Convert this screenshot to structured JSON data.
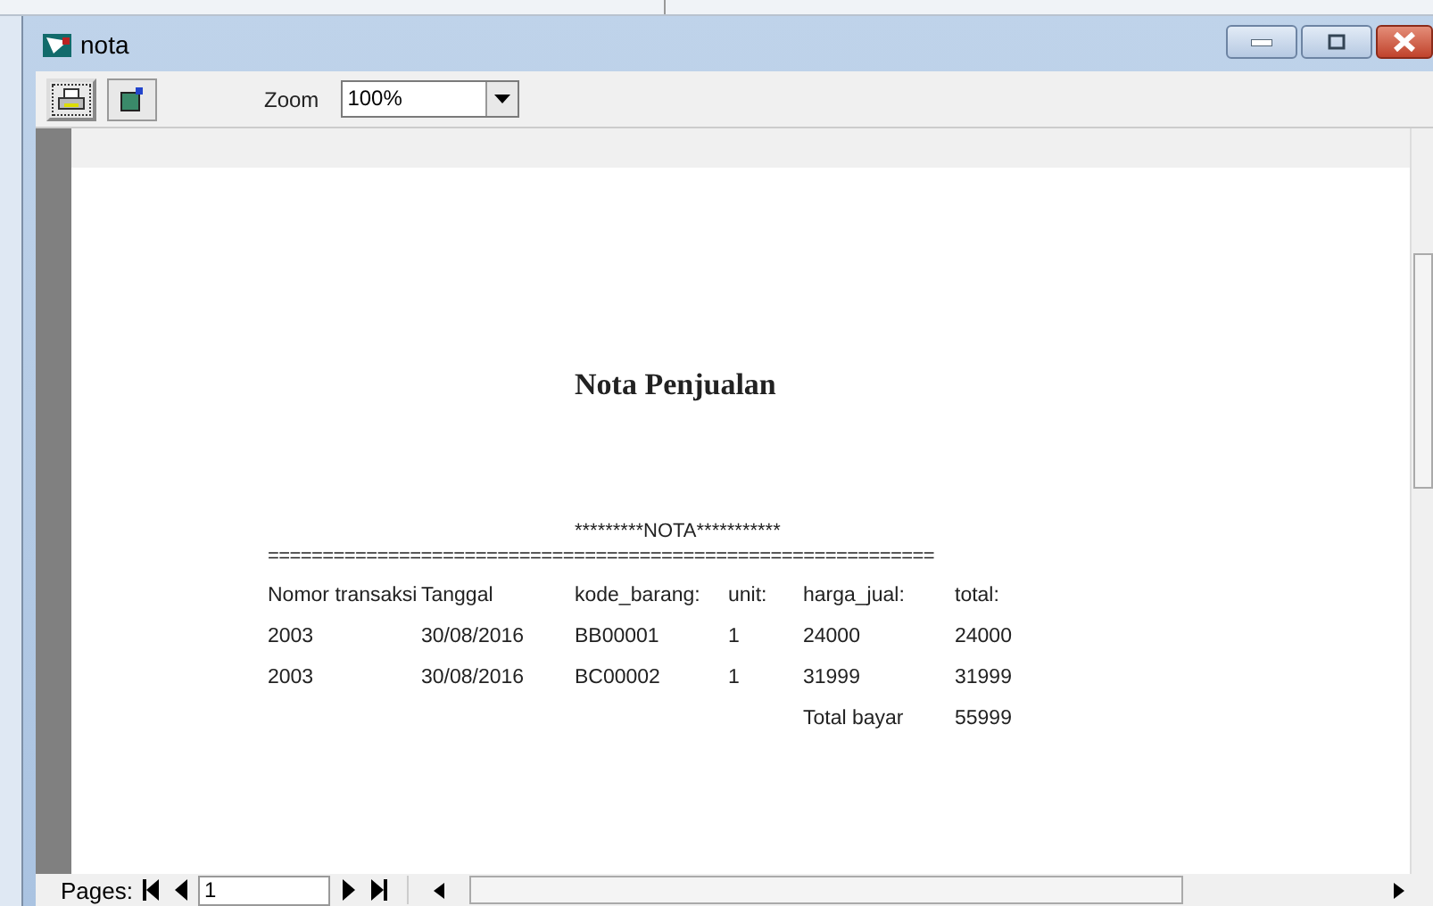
{
  "window": {
    "title": "nota"
  },
  "toolbar": {
    "zoom_label": "Zoom",
    "zoom_value": "100%"
  },
  "report": {
    "title": "Nota Penjualan",
    "banner": "*********NOTA***********",
    "separator": "=============================================================",
    "columns": [
      "Nomor transaksi",
      "Tanggal",
      "kode_barang:",
      "unit:",
      "harga_jual:",
      "total:"
    ],
    "rows": [
      [
        "2003",
        "30/08/2016",
        "BB00001",
        "1",
        "24000",
        "24000"
      ],
      [
        "2003",
        "30/08/2016",
        "BC00002",
        "1",
        "31999",
        "31999"
      ]
    ],
    "total_label": "Total bayar",
    "total_value": "55999"
  },
  "pager": {
    "label": "Pages:",
    "page": "1"
  }
}
